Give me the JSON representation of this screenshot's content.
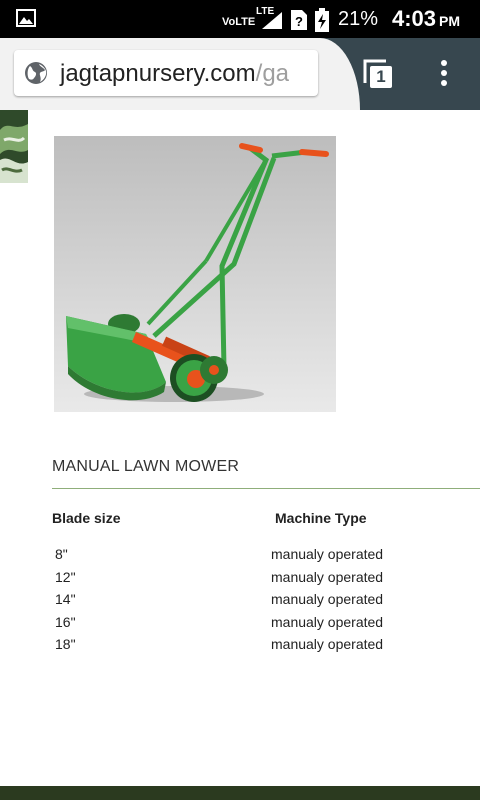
{
  "status_bar": {
    "network_label": "VoLTE",
    "lte_label": "LTE",
    "battery_percent": "21%",
    "time": "4:03",
    "time_suffix": "PM"
  },
  "browser": {
    "url_domain": "jagtapnursery.com",
    "url_path": "/ga",
    "tab_count": "1",
    "icons": [
      "globe-icon",
      "tabs-icon",
      "overflow-menu-icon"
    ]
  },
  "product": {
    "title": "MANUAL LAWN MOWER",
    "image_alt_subject": "lawn-mower-image"
  },
  "spec_table": {
    "headers": [
      "Blade size",
      "Machine Type"
    ],
    "rows": [
      [
        "8\"",
        "manualy operated"
      ],
      [
        "12\"",
        "manualy operated"
      ],
      [
        "14\"",
        "manualy operated"
      ],
      [
        "16\"",
        "manualy operated"
      ],
      [
        "18\"",
        "manualy operated"
      ]
    ]
  },
  "colors": {
    "toolbar": "#37474f",
    "mower_green": "#3aa345",
    "mower_orange": "#e8521c",
    "footer": "#2b3a1f"
  }
}
